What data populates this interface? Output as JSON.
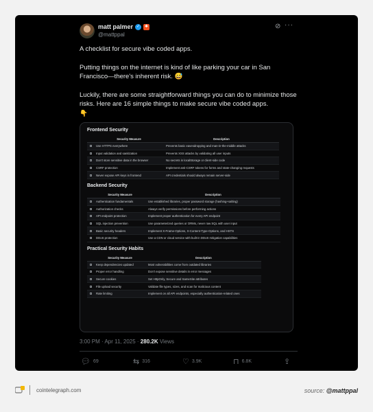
{
  "tweet": {
    "author_name": "matt palmer",
    "handle": "@mattppal",
    "paragraphs": [
      "A checklist for secure vibe coded apps.",
      "Putting things on the internet is kind of like parking your car in San Francisco—there's inherent risk. 😅",
      "Luckily, there are some straightforward things you can do to minimize those risks. Here are 16 simple things to make secure vibe coded apps."
    ],
    "hand_emoji": "👇",
    "timestamp": "3:00 PM · Apr 11, 2025 · ",
    "views_count": "280.2K",
    "views_label": " Views",
    "actions": {
      "replies": "69",
      "reposts": "316",
      "likes": "3.9K",
      "bookmarks": "6.8K"
    }
  },
  "checklist": {
    "sections": [
      {
        "title": "Frontend Security",
        "col_measure": "Security Measure",
        "col_desc": "Description",
        "rows": [
          [
            "Use HTTPS everywhere",
            "Prevents basic eavesdropping and man-in-the-middle attacks"
          ],
          [
            "Input validation and sanitization",
            "Prevents XSS attacks by validating all user inputs"
          ],
          [
            "Don't store sensitive data in the browser",
            "No secrets in localStorage or client-side code"
          ],
          [
            "CSRF protection",
            "Implement anti-CSRF tokens for forms and state-changing requests"
          ],
          [
            "Never expose API keys in frontend",
            "API credentials should always remain server-side"
          ]
        ]
      },
      {
        "title": "Backend Security",
        "col_measure": "Security Measure",
        "col_desc": "Description",
        "rows": [
          [
            "Authentication fundamentals",
            "Use established libraries, proper password storage (hashing+salting)"
          ],
          [
            "Authorization checks",
            "Always verify permissions before performing actions"
          ],
          [
            "API endpoint protection",
            "Implement proper authentication for every API endpoint"
          ],
          [
            "SQL injection prevention",
            "Use parameterized queries or ORMs, never raw SQL with user input"
          ],
          [
            "Basic security headers",
            "Implement X-Frame-Options, X-Content-Type-Options, and HSTS"
          ],
          [
            "DDoS protection",
            "Use a CDN or cloud service with built-in DDoS mitigation capabilities"
          ]
        ]
      },
      {
        "title": "Practical Security Habits",
        "col_measure": "Security Measure",
        "col_desc": "Description",
        "rows": [
          [
            "Keep dependencies updated",
            "Most vulnerabilities come from outdated libraries"
          ],
          [
            "Proper error handling",
            "Don't expose sensitive details in error messages"
          ],
          [
            "Secure cookies",
            "Set HttpOnly, Secure and SameSite attributes"
          ],
          [
            "File upload security",
            "Validate file types, sizes, and scan for malicious content"
          ],
          [
            "Rate limiting",
            "Implement on all API endpoints, especially authentication-related ones"
          ]
        ]
      }
    ]
  },
  "footer": {
    "site": "cointelegraph.com",
    "source_prefix": "source: ",
    "source_handle": "@mattppal"
  },
  "colors": {
    "verified": "#1d9bf0",
    "background": "#000000"
  }
}
